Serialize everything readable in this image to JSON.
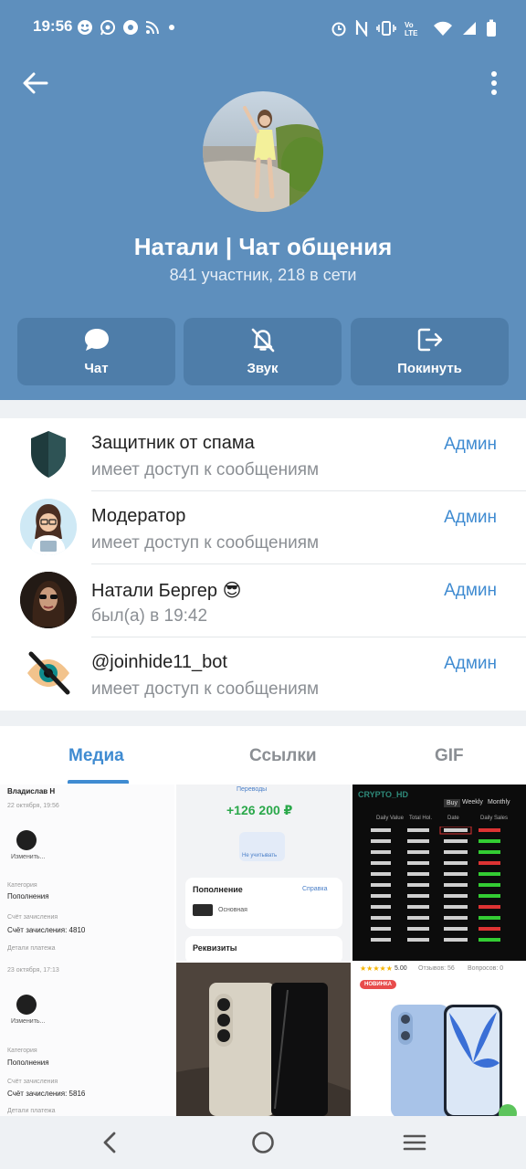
{
  "status_bar": {
    "time": "19:56",
    "left_icons": [
      "pacman-icon",
      "whatsapp-icon",
      "settings-sync-icon",
      "rss-icon",
      "dot-icon"
    ],
    "right_icons": [
      "alarm-icon",
      "nfc-icon",
      "vibrate-icon",
      "volte-icon",
      "wifi-icon",
      "signal-icon",
      "battery-icon"
    ]
  },
  "header": {
    "title": "Натали | Чат общения",
    "subtitle": "841 участник, 218 в сети",
    "bg_color": "#5e8fbd"
  },
  "actions": [
    {
      "label": "Чат",
      "icon": "chat-bubble-icon"
    },
    {
      "label": "Звук",
      "icon": "bell-off-icon"
    },
    {
      "label": "Покинуть",
      "icon": "leave-icon"
    }
  ],
  "members": [
    {
      "name": "Защитник от спама",
      "status": "имеет доступ к сообщениям",
      "role": "Админ",
      "avatar": "shield-icon"
    },
    {
      "name": "Модератор",
      "status": "имеет доступ к сообщениям",
      "role": "Админ",
      "avatar": "moderator-avatar"
    },
    {
      "name": "Натали Бергер 😎",
      "status": "был(а) в 19:42",
      "role": "Админ",
      "avatar": "user-photo"
    },
    {
      "name": "@joinhide11_bot",
      "status": "имеет доступ к сообщениям",
      "role": "Админ",
      "avatar": "crossed-eye-icon"
    }
  ],
  "tabs": [
    {
      "label": "Медиа",
      "active": true
    },
    {
      "label": "Ссылки",
      "active": false
    },
    {
      "label": "GIF",
      "active": false
    }
  ],
  "media": {
    "cell1": {
      "name": "Владислав Н",
      "date1": "22 октября, 19:56",
      "edit1": "Изменить...",
      "cat_label1": "Категория",
      "cat_value1": "Пополнения",
      "acc_label1": "Счёт зачисления",
      "acc_value1": "Счёт зачисления: 4810",
      "details1": "Детали платежа",
      "date2": "23 октября, 17:13",
      "edit2": "Изменить...",
      "cat_label2": "Категория",
      "cat_value2": "Пополнения",
      "acc_label2": "Счёт зачисления",
      "acc_value2": "Счёт зачисления: 5816",
      "details2": "Детали платежа"
    },
    "cell2": {
      "transfers": "Переводы",
      "amount": "+126 200 ₽",
      "unused": "Не учитывать",
      "topup": "Пополнение",
      "help": "Справка",
      "card": "Основная",
      "requisites": "Реквизиты"
    },
    "cell3": {
      "brand": "CRYPTO_HD",
      "tab_buy": "Buy",
      "tab_weekly": "Weekly",
      "tab_monthly": "Monthly",
      "col1": "Daily Value",
      "col2": "Total Hol.",
      "col3": "Date",
      "col4": "Daily Sales"
    },
    "cell6": {
      "rating": "5.00",
      "reviews": "Отзывов: 56",
      "questions": "Вопросов: 0",
      "badge": "НОВИНКА"
    }
  }
}
